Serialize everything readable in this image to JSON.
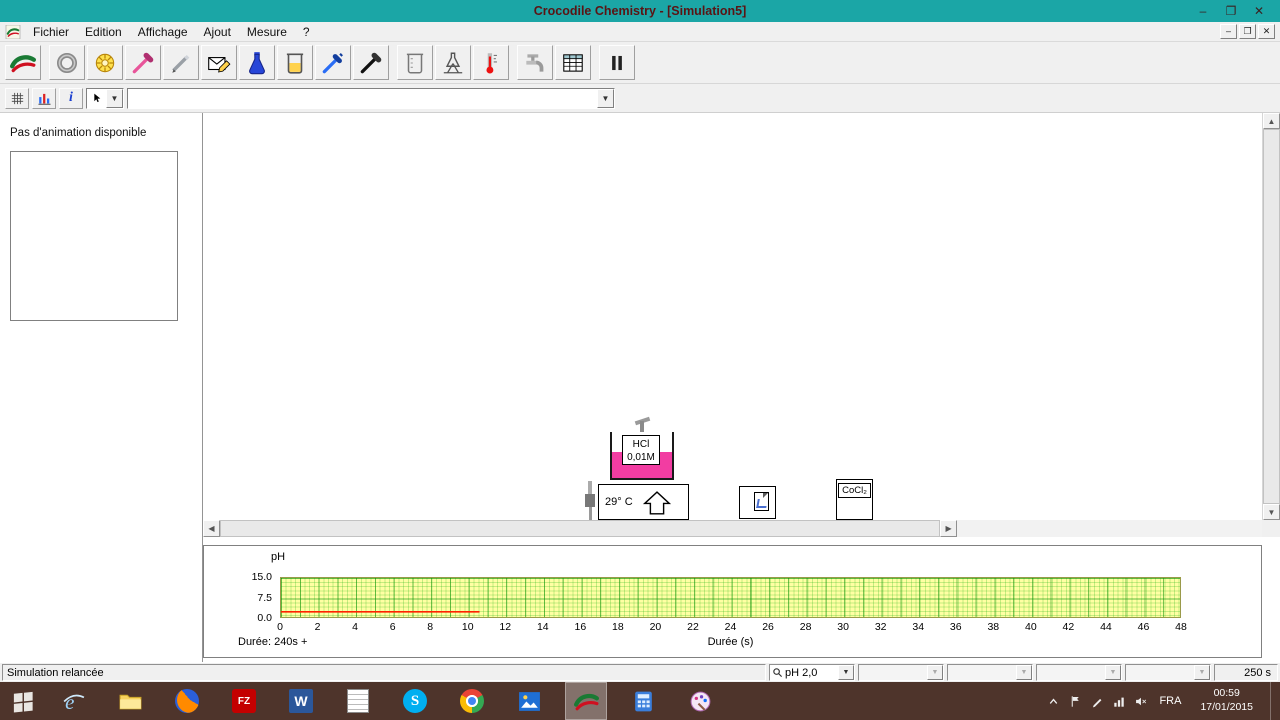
{
  "window": {
    "title": "Crocodile Chemistry - [Simulation5]",
    "controls": {
      "minimize": "–",
      "restore": "❐",
      "close": "✕"
    }
  },
  "menu": {
    "items": [
      "Fichier",
      "Edition",
      "Affichage",
      "Ajout",
      "Mesure",
      "?"
    ]
  },
  "toolbar": {
    "groups": [
      [
        "crocodile-logo"
      ],
      [
        "wheel",
        "gear-yellow",
        "dropper-pink",
        "pencil",
        "envelope-edit",
        "flask-blue",
        "beaker-yellow",
        "syringe-blue",
        "pen-black"
      ],
      [
        "beaker-outline",
        "flask-stand",
        "thermometer"
      ],
      [
        "tap",
        "data-table"
      ],
      [
        "pause"
      ]
    ]
  },
  "toolbar2": {
    "buttons": [
      "grid-small",
      "chart-small",
      "info"
    ],
    "combo_value": ""
  },
  "left_panel": {
    "message": "Pas d'animation disponible"
  },
  "canvas": {
    "beaker": {
      "label_lines": [
        "HCl",
        "0,01M"
      ],
      "liquid_color": "#f23da2"
    },
    "heater": {
      "temp": "29° C"
    },
    "bottle": {
      "label": "CoCl₂"
    }
  },
  "chart_data": {
    "type": "line",
    "title": "pH",
    "xlabel": "Durée (s)",
    "duration_text": "Durée:  240s +",
    "xlim": [
      0,
      48
    ],
    "ylim": [
      0,
      15
    ],
    "x_ticks": [
      0,
      2,
      4,
      6,
      8,
      10,
      12,
      14,
      16,
      18,
      20,
      22,
      24,
      26,
      28,
      30,
      32,
      34,
      36,
      38,
      40,
      42,
      44,
      46,
      48
    ],
    "y_ticks": [
      15.0,
      7.5,
      0.0
    ],
    "y_tick_labels": [
      "15.0",
      "7.5",
      "0.0"
    ],
    "grid": true,
    "plot_bg": "#ffffa3",
    "legend": "none",
    "series": [
      {
        "name": "pH",
        "color": "#ff2200",
        "points": [
          [
            0,
            2.0
          ],
          [
            10.6,
            2.0
          ]
        ]
      }
    ]
  },
  "status_bar": {
    "message": "Simulation relancée",
    "ph_value": "pH 2,0",
    "extra_combos": [
      "",
      "",
      "",
      ""
    ],
    "sim_time": "250 s"
  },
  "taskbar": {
    "apps": [
      "start",
      "ie",
      "explorer",
      "firefox",
      "filezilla",
      "word",
      "notepad",
      "skype",
      "chrome",
      "photos",
      "crocodile",
      "calculator",
      "paint"
    ],
    "active_app": "crocodile",
    "tray": {
      "language": "FRA",
      "time": "00:59",
      "date": "17/01/2015"
    }
  },
  "colors": {
    "titlebar": "#1ba6a6",
    "taskbar": "#4e342b",
    "liquid": "#f23da2",
    "plot_line": "#ff2200"
  }
}
